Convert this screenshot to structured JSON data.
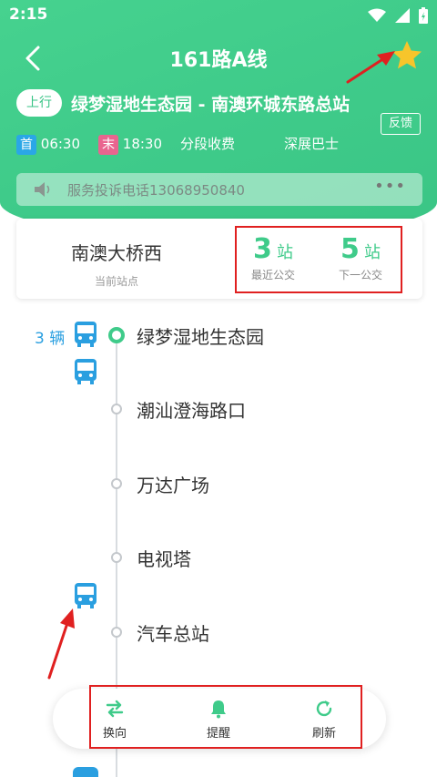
{
  "status_bar": {
    "time": "2:15"
  },
  "header": {
    "route_title": "161路A线",
    "direction_badge": "上行",
    "direction_route": "绿梦湿地生态园 - 南澳环城东路总站",
    "feedback_label": "反馈"
  },
  "info": {
    "first_tag": "首",
    "first_time": "06:30",
    "last_tag": "末",
    "last_time": "18:30",
    "fare": "分段收费",
    "operator": "深展巴士"
  },
  "notice": {
    "text": "服务投诉电话13068950840",
    "more": "•••"
  },
  "current_station": {
    "name": "南澳大桥西",
    "label": "当前站点",
    "nearest": {
      "value": "3",
      "unit": "站",
      "label": "最近公交"
    },
    "next": {
      "value": "5",
      "unit": "站",
      "label": "下一公交"
    }
  },
  "bus_count": "3 辆",
  "stops": [
    {
      "name": "绿梦湿地生态园"
    },
    {
      "name": "潮汕澄海路口"
    },
    {
      "name": "万达广场"
    },
    {
      "name": "电视塔"
    },
    {
      "name": "汽车总站"
    }
  ],
  "toolbar": {
    "switch_label": "换向",
    "remind_label": "提醒",
    "refresh_label": "刷新"
  },
  "colors": {
    "accent": "#3fcb8a",
    "bus_blue": "#2a9fe0",
    "highlight_red": "#e02020",
    "star": "#f7c52b"
  }
}
